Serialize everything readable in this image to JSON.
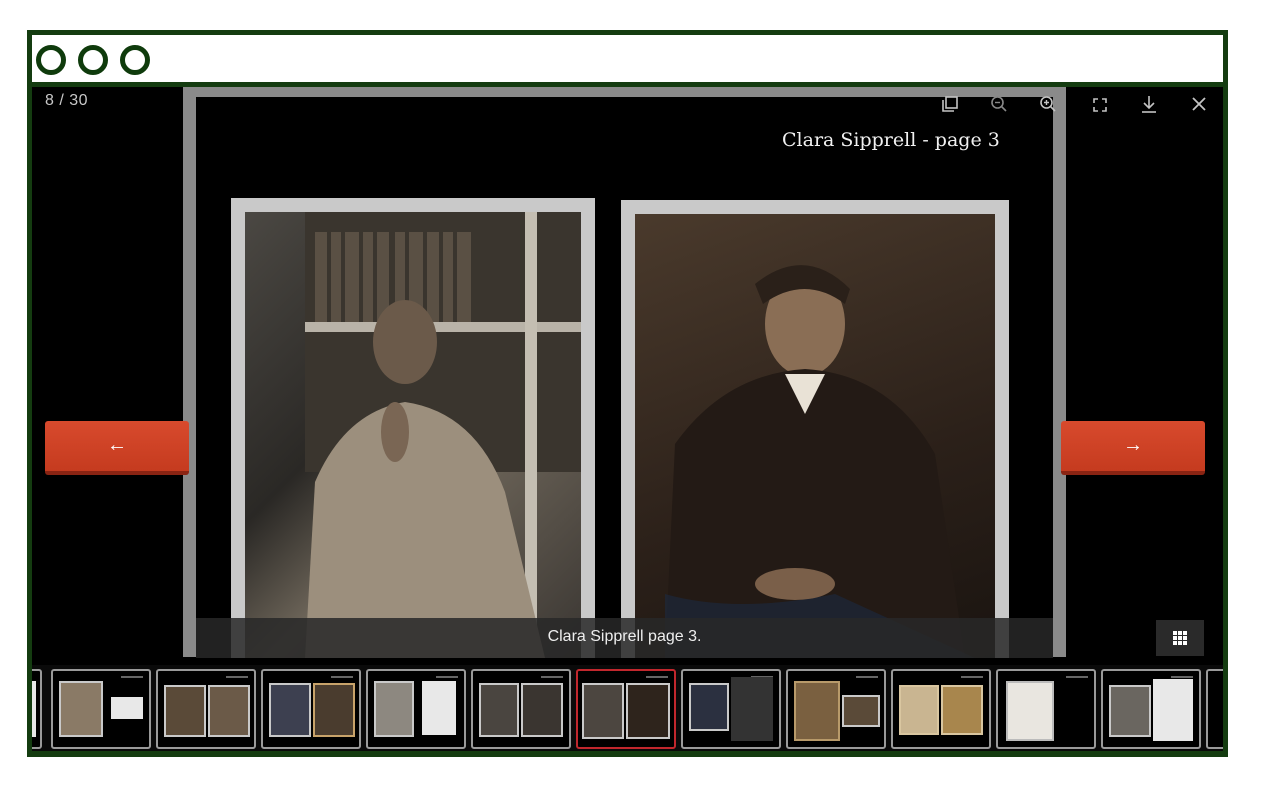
{
  "counter": "8 / 30",
  "page_title": "Clara Sipprell - page 3",
  "caption": "Clara Sipprell page 3.",
  "nav": {
    "prev_label": "←",
    "next_label": "→"
  },
  "toolbar": {
    "copy_icon": "copy-icon",
    "zoom_out_icon": "zoom-out-icon",
    "zoom_in_icon": "zoom-in-icon",
    "fullscreen_icon": "fullscreen-icon",
    "download_icon": "download-icon",
    "close_icon": "close-icon"
  },
  "thumbnails": {
    "count_visible": 12,
    "active_index": 6
  },
  "colors": {
    "frame": "#143c10",
    "nav_button": "#d84a2d",
    "active_thumb": "#c1272d"
  }
}
